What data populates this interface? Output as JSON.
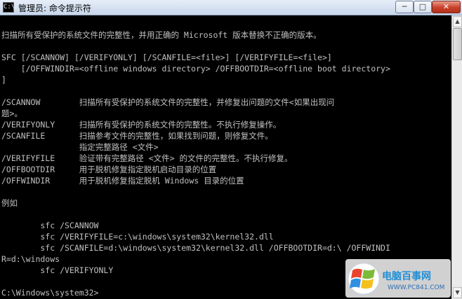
{
  "window": {
    "title": "管理员: 命令提示符",
    "icon_label": "C:\\",
    "minimize_label": "─",
    "maximize_label": "□",
    "close_label": "✕"
  },
  "console": {
    "lines": [
      "扫描所有受保护的系统文件的完整性，并用正确的 Microsoft 版本替换不正确的版本。",
      "",
      "SFC [/SCANNOW] [/VERIFYONLY] [/SCANFILE=<file>] [/VERIFYFILE=<file>]",
      "    [/OFFWINDIR=<offline windows directory> /OFFBOOTDIR=<offline boot directory>",
      "]",
      "",
      "/SCANNOW        扫描所有受保护的系统文件的完整性，并修复出问题的文件<如果出现问",
      "题>。",
      "/VERIFYONLY     扫描所有受保护的系统文件的完整性。不执行修复操作。",
      "/SCANFILE       扫描参考文件的完整性，如果找到问题，则修复文件。",
      "                指定完整路径 <文件>",
      "/VERIFYFILE     验证带有完整路径 <文件> 的文件的完整性。不执行修复。",
      "/OFFBOOTDIR     用于脱机修复指定脱机启动目录的位置",
      "/OFFWINDIR      用于脱机修复指定脱机 Windows 目录的位置",
      "",
      "例如",
      "",
      "        sfc /SCANNOW",
      "        sfc /VERIFYFILE=c:\\windows\\system32\\kernel32.dll",
      "        sfc /SCANFILE=d:\\windows\\system32\\kernel32.dll /OFFBOOTDIR=d:\\ /OFFWINDI",
      "R=d:\\windows",
      "        sfc /VERIFYONLY",
      "",
      "",
      "C:\\Windows\\system32>"
    ]
  },
  "scrollbar": {
    "up_arrow": "▲",
    "down_arrow": "▼"
  },
  "watermark": {
    "brand_text": "电脑百事网",
    "url_text": "WWW.PC841.COM"
  },
  "colors": {
    "console_bg": "#000000",
    "console_text": "#c0c0c0",
    "watermark_blue": "#1f8fd6"
  }
}
